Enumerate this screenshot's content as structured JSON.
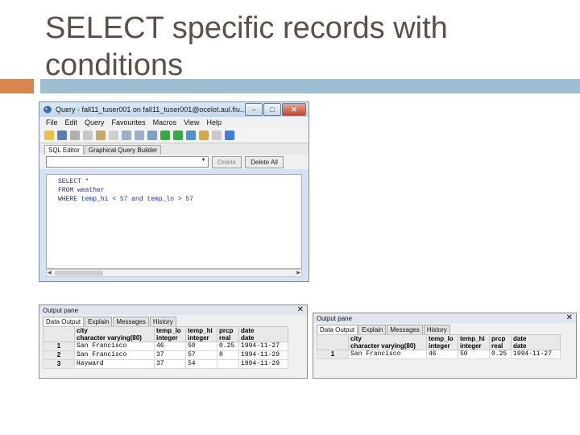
{
  "slide": {
    "title": "SELECT specific records with conditions"
  },
  "query_window": {
    "title": "Query - fall11_tuser001 on fall11_tuser001@ocelot.aul.fiu...",
    "window_buttons": [
      "–",
      "□",
      "✕"
    ],
    "menu": [
      "File",
      "Edit",
      "Query",
      "Favourites",
      "Macros",
      "View",
      "Help"
    ],
    "tabs": [
      "SQL Editor",
      "Graphical Query Builder"
    ],
    "filter": {
      "delete_label": "Delete",
      "delete_all_label": "Delete All"
    },
    "sql_lines": [
      "SELECT *",
      "FROM weather",
      "WHERE temp_hi < 57 and temp_lo > 57"
    ]
  },
  "output_left": {
    "header": "Output pane",
    "tabs": [
      "Data Output",
      "Explain",
      "Messages",
      "History"
    ],
    "columns": [
      {
        "name": "city",
        "type": "character varying(80)"
      },
      {
        "name": "temp_lo",
        "type": "integer"
      },
      {
        "name": "temp_hi",
        "type": "integer"
      },
      {
        "name": "prcp",
        "type": "real"
      },
      {
        "name": "date",
        "type": "date"
      }
    ],
    "rows": [
      {
        "num": "1",
        "cells": [
          "San Francisco",
          "46",
          "50",
          "0.25",
          "1994-11-27"
        ]
      },
      {
        "num": "2",
        "cells": [
          "San Francisco",
          "37",
          "57",
          "0",
          "1994-11-29"
        ]
      },
      {
        "num": "3",
        "cells": [
          "Hayward",
          "37",
          "54",
          "",
          "1994-11-29"
        ]
      }
    ]
  },
  "output_right": {
    "header": "Output pane",
    "tabs": [
      "Data Output",
      "Explain",
      "Messages",
      "History"
    ],
    "columns": [
      {
        "name": "city",
        "type": "character varying(80)"
      },
      {
        "name": "temp_lo",
        "type": "integer"
      },
      {
        "name": "temp_hi",
        "type": "integer"
      },
      {
        "name": "prcp",
        "type": "real"
      },
      {
        "name": "date",
        "type": "date"
      }
    ],
    "rows": [
      {
        "num": "1",
        "cells": [
          "San Francisco",
          "46",
          "50",
          "0.25",
          "1994-11-27"
        ]
      }
    ]
  },
  "colors": {
    "title": "#5c4f44",
    "accent_orange": "#d9864e",
    "accent_blue": "#9dbfd1"
  }
}
